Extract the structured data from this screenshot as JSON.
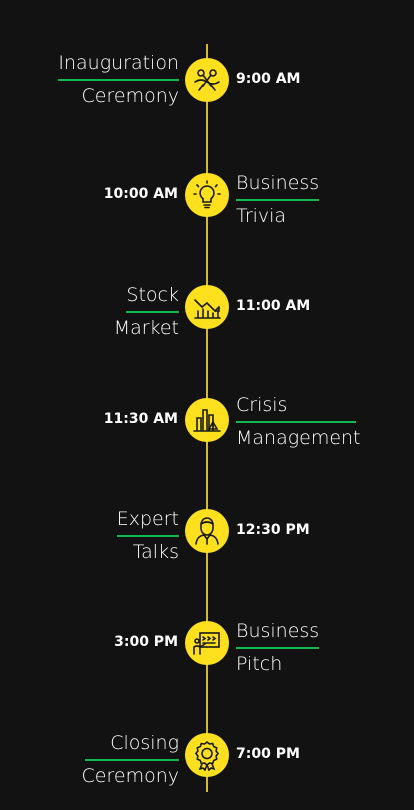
{
  "accent": "#ffe01f",
  "underline": "#12b84f",
  "events": [
    {
      "title_line1": "Inauguration",
      "title_line2": "Ceremony",
      "time": "9:00 AM",
      "icon": "ribbon-cutting-icon"
    },
    {
      "title_line1": "Business",
      "title_line2": "Trivia",
      "time": "10:00 AM",
      "icon": "lightbulb-icon"
    },
    {
      "title_line1": "Stock",
      "title_line2": "Market",
      "time": "11:00 AM",
      "icon": "stock-chart-icon"
    },
    {
      "title_line1": "Crisis",
      "title_line2": "Management",
      "time": "11:30 AM",
      "icon": "crisis-chart-icon"
    },
    {
      "title_line1": "Expert",
      "title_line2": "Talks",
      "time": "12:30 PM",
      "icon": "speaker-person-icon"
    },
    {
      "title_line1": "Business",
      "title_line2": "Pitch",
      "time": "3:00 PM",
      "icon": "presentation-board-icon"
    },
    {
      "title_line1": "Closing",
      "title_line2": "Ceremony",
      "time": "7:00 PM",
      "icon": "award-badge-icon"
    }
  ]
}
